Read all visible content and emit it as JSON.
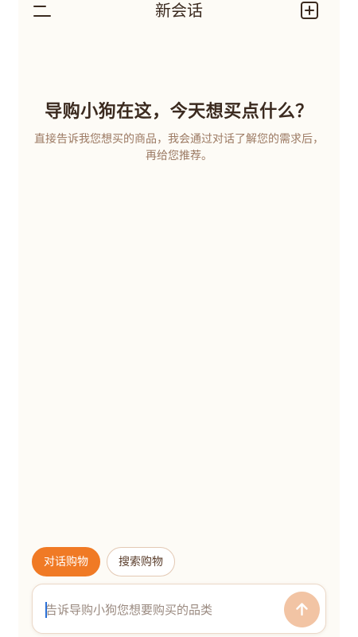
{
  "header": {
    "title": "新会话",
    "menu_icon": "menu-icon",
    "new_chat_icon": "plus-square-icon"
  },
  "hero": {
    "title": "导购小狗在这，今天想买点什么？",
    "subtitle": "直接告诉我您想买的商品，我会通过对话了解您的需求后，再给您推荐。"
  },
  "modes": {
    "items": [
      {
        "label": "对话购物",
        "active": true
      },
      {
        "label": "搜索购物",
        "active": false
      }
    ]
  },
  "composer": {
    "placeholder": "告诉导购小狗您想要购买的品类",
    "send_icon": "arrow-up-icon"
  },
  "colors": {
    "background": "#fdfbf6",
    "accent": "#f07a25",
    "send_button": "#f2c4a4",
    "text_primary": "#3b2a1f",
    "text_secondary": "#9c7a63"
  }
}
